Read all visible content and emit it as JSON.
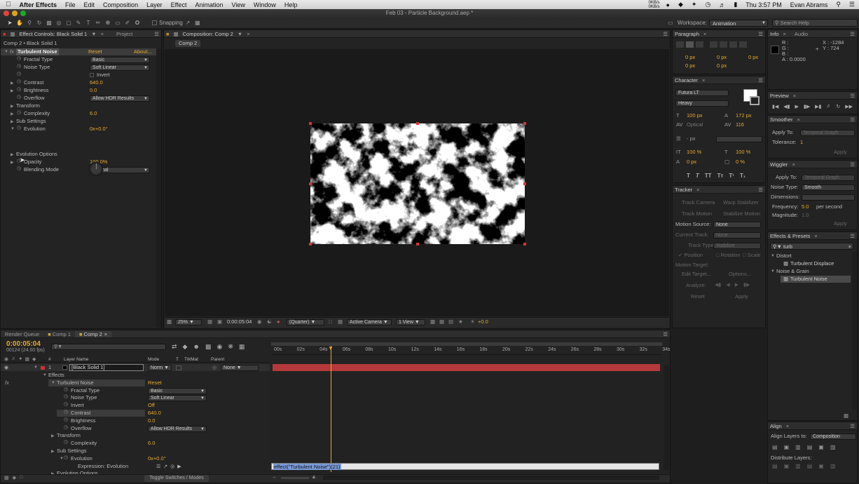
{
  "menubar": {
    "app": "After Effects",
    "items": [
      "File",
      "Edit",
      "Composition",
      "Layer",
      "Effect",
      "Animation",
      "View",
      "Window",
      "Help"
    ],
    "status": {
      "clock": "Thu 3:57 PM",
      "user": "Evan Abrams",
      "kb1": "0KB/s",
      "kb2": "0KB/s"
    }
  },
  "window": {
    "title": "Feb 03 - Particle Background.aep *"
  },
  "toolbar": {
    "snapping": "Snapping",
    "workspace_label": "Workspace:",
    "workspace_value": "Animation",
    "search_placeholder": "Search Help"
  },
  "effect_controls": {
    "tab": "Effect Controls: Black Solid 1",
    "tab2": "Project",
    "breadcrumb": "Comp 2 • Black Solid 1",
    "effect_name": "Turbulent Noise",
    "reset": "Reset",
    "about": "About...",
    "props": [
      {
        "label": "Fractal Type",
        "value": "Basic",
        "kind": "select"
      },
      {
        "label": "Noise Type",
        "value": "Soft Linear",
        "kind": "select"
      },
      {
        "label": "",
        "value": "Invert",
        "kind": "check"
      },
      {
        "label": "Contrast",
        "value": "640.0",
        "kind": "num"
      },
      {
        "label": "Brightness",
        "value": "0.0",
        "kind": "num"
      },
      {
        "label": "Overflow",
        "value": "Allow HDR Results",
        "kind": "select"
      },
      {
        "label": "Transform",
        "value": "",
        "kind": "group"
      },
      {
        "label": "Complexity",
        "value": "6.0",
        "kind": "num"
      },
      {
        "label": "Sub Settings",
        "value": "",
        "kind": "group"
      },
      {
        "label": "Evolution",
        "value": "0x+0.0°",
        "kind": "num"
      },
      {
        "label": "Evolution Options",
        "value": "",
        "kind": "group"
      },
      {
        "label": "Opacity",
        "value": "100.0%",
        "kind": "num"
      },
      {
        "label": "Blending Mode",
        "value": "Normal",
        "kind": "select"
      }
    ]
  },
  "composition": {
    "tab": "Composition: Comp 2",
    "subtab": "Comp 2",
    "zoom": "25%",
    "timecode": "0:00:05:04",
    "resolution": "(Quarter)",
    "camera": "Active Camera",
    "view": "1 View",
    "exposure": "+0.0"
  },
  "paragraph": {
    "tab": "Paragraph",
    "fields": [
      "0 px",
      "0 px",
      "0 px",
      "0 px",
      "0 px"
    ]
  },
  "character": {
    "tab": "Character",
    "font": "Futura LT",
    "style": "Heavy",
    "size": "100 px",
    "leading": "172 px",
    "kerning": "Optical",
    "tracking": "116",
    "stroke": "- px",
    "vscale": "100 %",
    "hscale": "100 %",
    "baseline": "0 px",
    "tsume": "0 %"
  },
  "tracker": {
    "tab": "Tracker",
    "track_camera": "Track Camera",
    "warp_stabilizer": "Warp Stabilizer",
    "track_motion": "Track Motion",
    "stabilize_motion": "Stabilize Motion",
    "motion_source_label": "Motion Source:",
    "motion_source": "None",
    "current_track_label": "Current Track:",
    "current_track": "None",
    "track_type_label": "Track Type:",
    "track_type": "Stabilize",
    "position": "Position",
    "rotation": "Rotation",
    "scale": "Scale",
    "motion_target": "Motion Target:",
    "edit_target": "Edit Target...",
    "options": "Options...",
    "analyze": "Analyze:",
    "reset": "Reset",
    "apply": "Apply"
  },
  "info": {
    "tab": "Info",
    "tab2": "Audio",
    "r": "R :",
    "g": "G :",
    "b": "B :",
    "a": "A : 0.0000",
    "x": "X : -1284",
    "y": "Y : 724"
  },
  "preview": {
    "tab": "Preview"
  },
  "smoother": {
    "tab": "Smoother",
    "apply_to_label": "Apply To:",
    "apply_to": "Temporal Graph",
    "tolerance_label": "Tolerance:",
    "tolerance": "1",
    "apply": "Apply"
  },
  "wiggler": {
    "tab": "Wiggler",
    "apply_to_label": "Apply To:",
    "apply_to": "Temporal Graph",
    "noise_type_label": "Noise Type:",
    "noise_type": "Smooth",
    "dimensions_label": "Dimensions:",
    "frequency_label": "Frequency:",
    "frequency": "5.0",
    "per_second": "per second",
    "magnitude_label": "Magnitude:",
    "magnitude": "1.0",
    "apply": "Apply"
  },
  "effects_presets": {
    "tab": "Effects & Presets",
    "search": "turb",
    "items": [
      {
        "label": "Distort",
        "kind": "group"
      },
      {
        "label": "Turbulent Displace",
        "kind": "item"
      },
      {
        "label": "Noise & Grain",
        "kind": "group"
      },
      {
        "label": "Turbulent Noise",
        "kind": "item",
        "selected": true
      }
    ]
  },
  "align": {
    "tab": "Align",
    "align_to_label": "Align Layers to:",
    "align_to": "Composition",
    "distribute": "Distribute Layers:"
  },
  "timeline": {
    "tabs": [
      "Render Queue",
      "Comp 1",
      "Comp 2"
    ],
    "timecode": "0:00:05:04",
    "fps": "00124 (24.00 fps)",
    "search_placeholder": "",
    "columns": {
      "num": "#",
      "layer_name": "Layer Name",
      "mode": "Mode",
      "t": "T",
      "trkmat": "TrkMat",
      "parent": "Parent"
    },
    "layer": {
      "num": "1",
      "name": "[Black Solid 1]",
      "mode": "Norm",
      "parent": "None"
    },
    "ruler": [
      "00s",
      "02s",
      "04s",
      "06s",
      "08s",
      "10s",
      "12s",
      "14s",
      "16s",
      "18s",
      "20s",
      "22s",
      "24s",
      "26s",
      "28s",
      "30s",
      "32s",
      "34s"
    ],
    "props": [
      {
        "label": "Effects",
        "value": "",
        "indent": 1
      },
      {
        "label": "Turbulent Noise",
        "value": "Reset",
        "indent": 2
      },
      {
        "label": "Fractal Type",
        "value": "Basic",
        "indent": 3
      },
      {
        "label": "Noise Type",
        "value": "Soft Linear",
        "indent": 3
      },
      {
        "label": "Invert",
        "value": "Off",
        "indent": 3
      },
      {
        "label": "Contrast",
        "value": "640.0",
        "indent": 3
      },
      {
        "label": "Brightness",
        "value": "0.0",
        "indent": 3
      },
      {
        "label": "Overflow",
        "value": "Allow HDR Results",
        "indent": 3
      },
      {
        "label": "Transform",
        "value": "",
        "indent": 2
      },
      {
        "label": "Complexity",
        "value": "6.0",
        "indent": 3
      },
      {
        "label": "Sub Settings",
        "value": "",
        "indent": 2
      },
      {
        "label": "Evolution",
        "value": "0x+0.0°",
        "indent": 3
      },
      {
        "label": "Expression: Evolution",
        "value": "",
        "indent": 4
      },
      {
        "label": "Evolution Options",
        "value": "",
        "indent": 2
      }
    ],
    "expression": "effect(\"Turbulent Noise\")(21)",
    "toggle": "Toggle Switches / Modes"
  }
}
